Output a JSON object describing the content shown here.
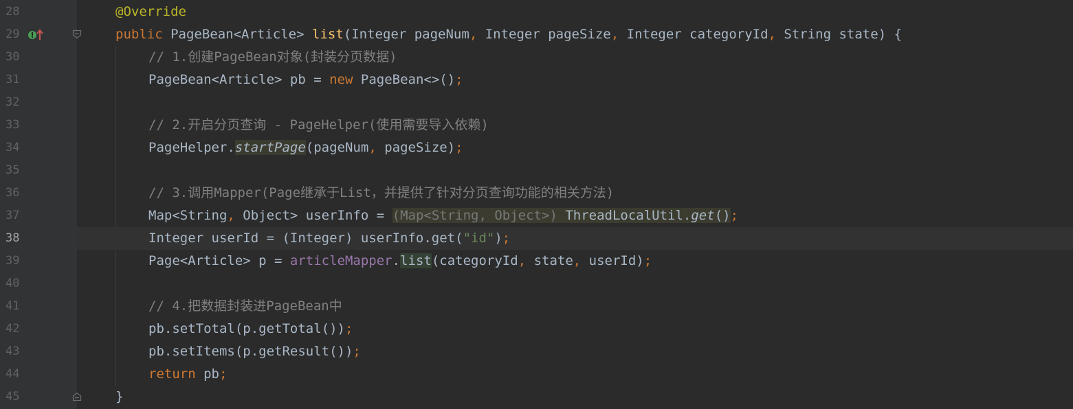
{
  "gutter": {
    "line_numbers": [
      "28",
      "29",
      "30",
      "31",
      "32",
      "33",
      "34",
      "35",
      "36",
      "37",
      "38",
      "39",
      "40",
      "41",
      "42",
      "43",
      "44",
      "45"
    ],
    "current_line": "38",
    "icons": {
      "implements": "implementation-marker-icon",
      "fold_open": "fold-start-icon",
      "fold_close": "fold-end-icon"
    }
  },
  "code": {
    "l28": {
      "annotation": "@Override"
    },
    "l29": {
      "kw_public": "public",
      "ret_type": "PageBean<Article>",
      "method": "list",
      "p1": "(Integer pageNum",
      "p2": "Integer pageSize",
      "p3": "Integer categoryId",
      "p4": "String state) {"
    },
    "l30": {
      "comment": "// 1.创建PageBean对象(封装分页数据)"
    },
    "l31": {
      "a": "PageBean<Article> pb = ",
      "kw_new": "new",
      "b": " PageBean<>()"
    },
    "l33": {
      "comment": "// 2.开启分页查询 - PageHelper(使用需要导入依赖)"
    },
    "l34": {
      "a": "PageHelper.",
      "method": "startPage",
      "b": "(pageNum",
      "c": "pageSize)"
    },
    "l36": {
      "comment": "// 3.调用Mapper(Page继承于List，并提供了针对分页查询功能的相关方法)"
    },
    "l37": {
      "a": "Map<String",
      "b": "Object> userInfo = ",
      "cast_open": "(",
      "cast_a": "Map<String",
      "cast_b": "Object>",
      "cast_close": ")",
      "c": " ThreadLocalUtil.",
      "method": "get",
      "parens": "()"
    },
    "l38": {
      "a": "Integer userId = (Integer) userInfo.get(",
      "str": "\"id\"",
      "b": ")"
    },
    "l39": {
      "a": "Page<Article> p = ",
      "field": "articleMapper",
      "dot": ".",
      "method": "list",
      "b": "(categoryId",
      "c": "state",
      "d": "userId)"
    },
    "l41": {
      "comment": "// 4.把数据封装进PageBean中"
    },
    "l42": {
      "a": "pb.setTotal(p.getTotal())"
    },
    "l43": {
      "a": "pb.setItems(p.getResult())"
    },
    "l44": {
      "kw_return": "return",
      "a": " pb"
    },
    "l45": {
      "brace": "}"
    }
  },
  "colors": {
    "background": "#2b2b2b",
    "gutter": "#313335",
    "keyword": "#cc7832",
    "annotation": "#bbb529",
    "method_decl": "#ffc66d",
    "comment": "#808080",
    "string": "#6a8759",
    "field": "#9876aa",
    "default_text": "#a9b7c6"
  }
}
